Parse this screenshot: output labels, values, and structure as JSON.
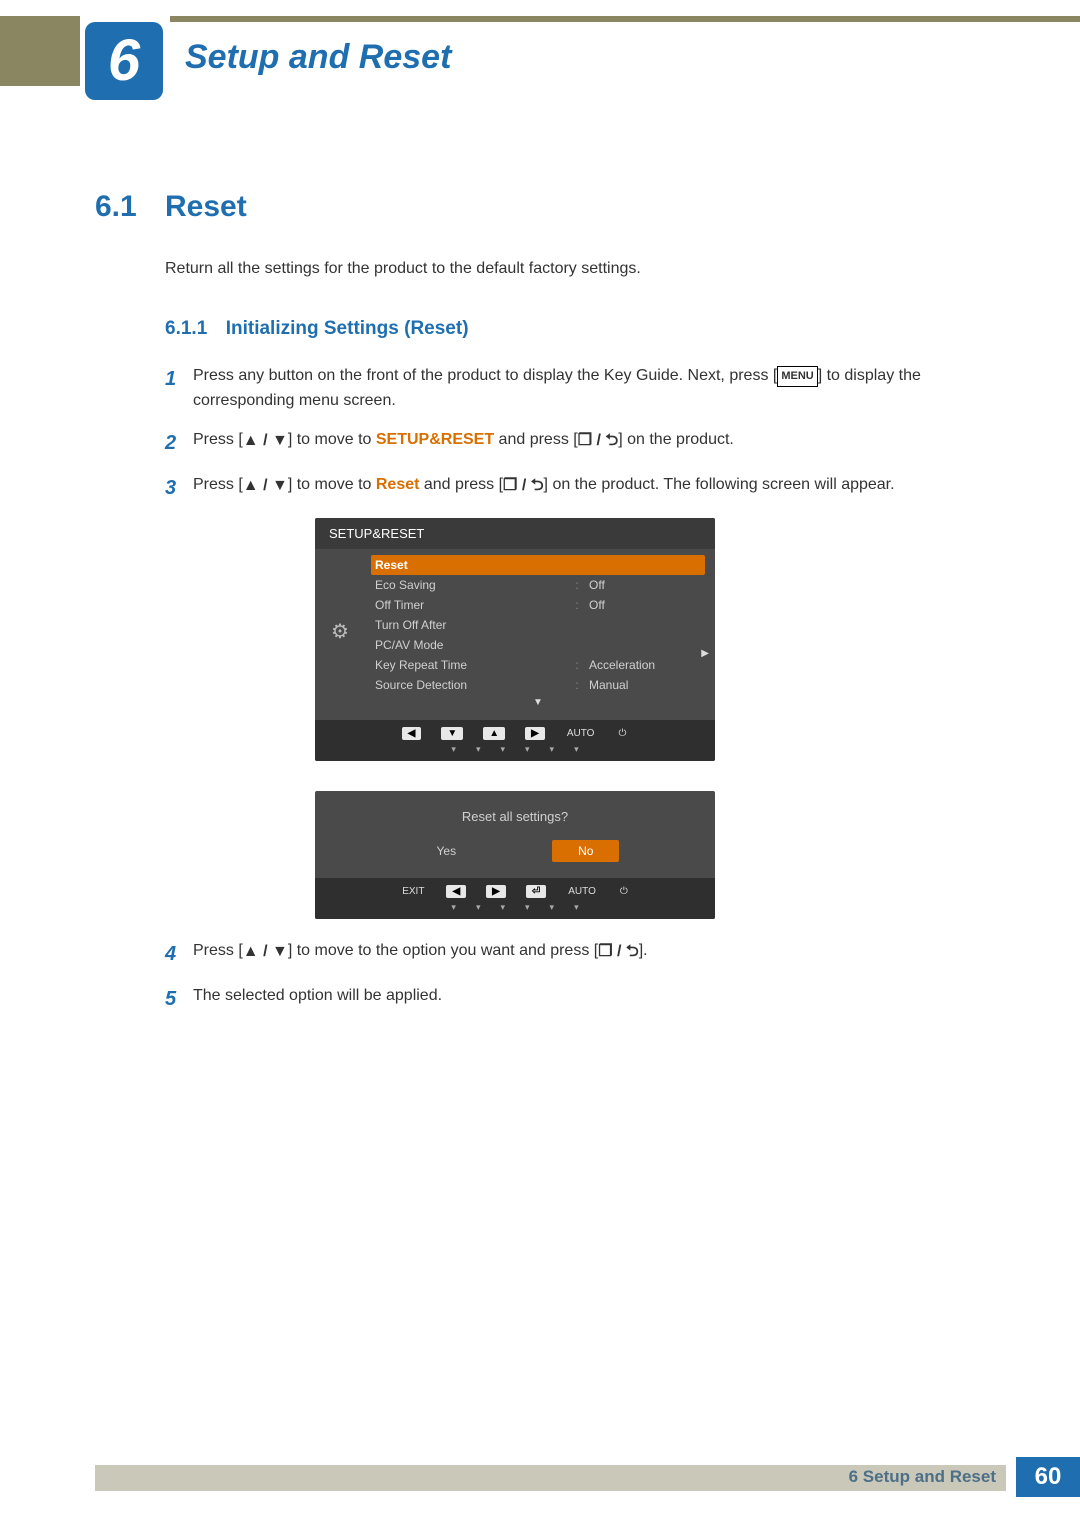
{
  "chapter": {
    "number": "6",
    "title": "Setup and Reset"
  },
  "section": {
    "number": "6.1",
    "title": "Reset",
    "intro": "Return all the settings for the product to the default factory settings."
  },
  "subsection": {
    "number": "6.1.1",
    "title": "Initializing Settings (Reset)"
  },
  "steps": {
    "s1a": "Press any button on the front of the product to display the Key Guide. Next, press [",
    "s1_menu": "MENU",
    "s1b": "] to display the corresponding menu screen.",
    "s2a": "Press [",
    "s2b": "] to move to ",
    "s2_hl": "SETUP&RESET",
    "s2c": " and press [",
    "s2d": "] on the product.",
    "s3a": "Press [",
    "s3b": "] to move to ",
    "s3_hl": "Reset",
    "s3c": " and press [",
    "s3d": "] on the product. The following screen will appear.",
    "s4a": "Press [",
    "s4b": "] to move to the option you want and press [",
    "s4c": "].",
    "s5": "The selected option will be applied."
  },
  "osd": {
    "title": "SETUP&RESET",
    "rows": [
      {
        "label": "Reset",
        "value": "",
        "sel": true
      },
      {
        "label": "Eco Saving",
        "value": "Off"
      },
      {
        "label": "Off Timer",
        "value": "Off"
      },
      {
        "label": "Turn Off After",
        "value": ""
      },
      {
        "label": "PC/AV Mode",
        "value": ""
      },
      {
        "label": "Key Repeat Time",
        "value": "Acceleration"
      },
      {
        "label": "Source Detection",
        "value": "Manual"
      }
    ],
    "nav": {
      "auto": "AUTO"
    }
  },
  "dialog": {
    "question": "Reset all settings?",
    "yes": "Yes",
    "no": "No",
    "exit": "EXIT",
    "auto": "AUTO"
  },
  "footer": {
    "text": "6 Setup and Reset",
    "page": "60"
  },
  "glyphs": {
    "updown": "▲ / ▼",
    "enter": "❐ / ⮌"
  }
}
